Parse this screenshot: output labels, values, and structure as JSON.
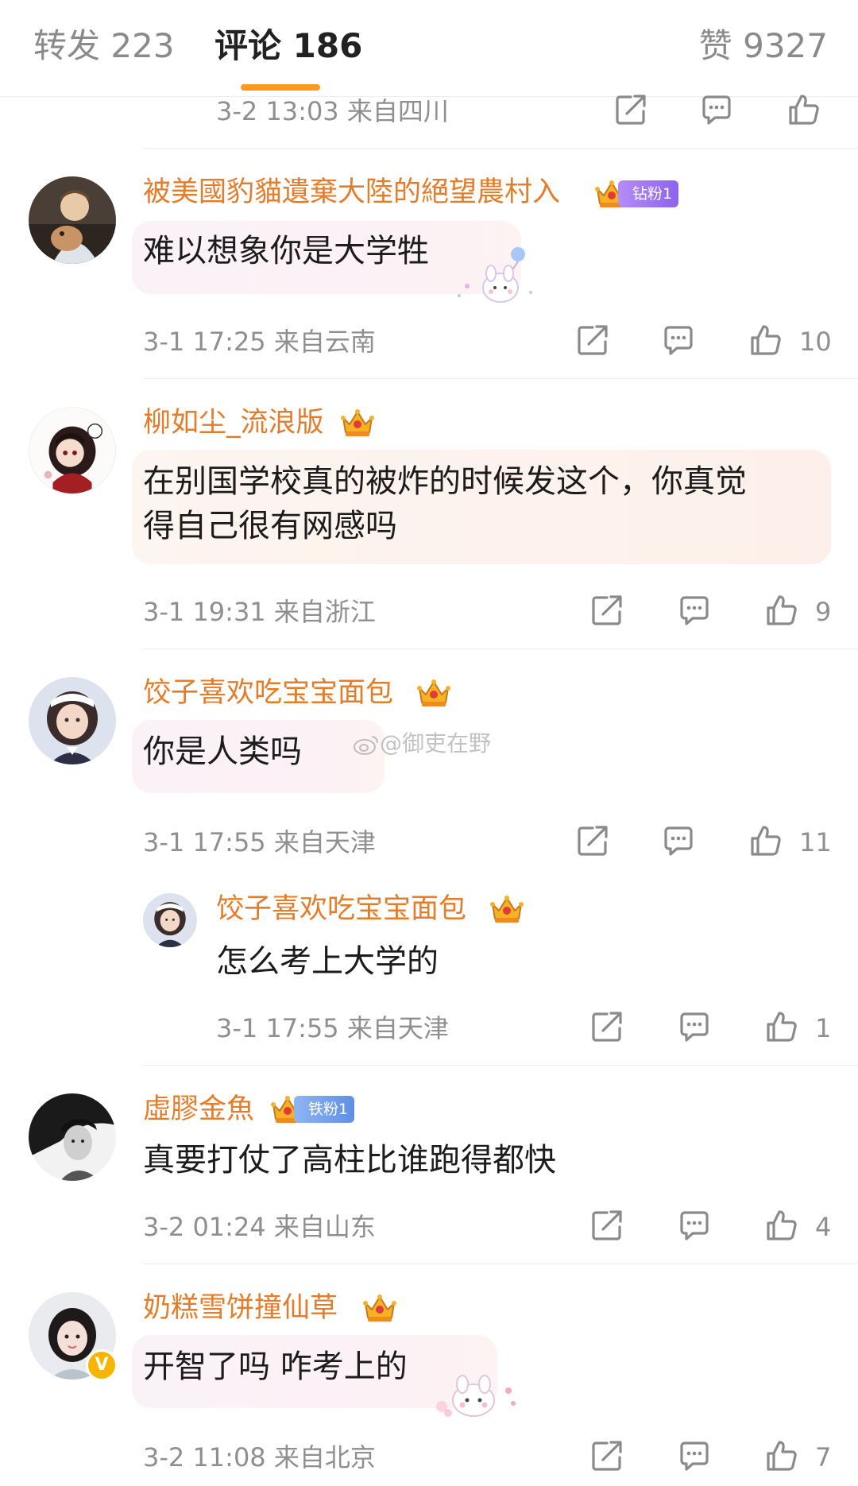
{
  "tabs": {
    "forward": "转发 223",
    "comments": "评论 186",
    "likes": "赞 9327"
  },
  "top_meta": "3-2 13:03 来自四川",
  "comments": [
    {
      "user": "被美國豹貓遺棄大陸的絕望農村入",
      "badge": "钻粉1",
      "text": "难以想象你是大学牲",
      "meta": "3-1 17:25 来自云南",
      "likes": "10"
    },
    {
      "user": "柳如尘_流浪版",
      "text_line1": "在别国学校真的被炸的时候发这个，你真觉",
      "text_line2": "得自己很有网感吗",
      "meta": "3-1 19:31 来自浙江",
      "likes": "9"
    },
    {
      "user": "饺子喜欢吃宝宝面包",
      "text": "你是人类吗",
      "meta": "3-1 17:55 来自天津",
      "likes": "11",
      "reply": {
        "user": "饺子喜欢吃宝宝面包",
        "text": "怎么考上大学的",
        "meta": "3-1 17:55 来自天津",
        "likes": "1"
      }
    },
    {
      "user": "虛膠金魚",
      "badge": "铁粉1",
      "text": "真要打仗了高柱比谁跑得都快",
      "meta": "3-2 01:24 来自山东",
      "likes": "4"
    },
    {
      "user": "奶糕雪饼撞仙草",
      "text": "开智了吗 咋考上的",
      "meta": "3-2 11:08 来自北京",
      "likes": "7"
    }
  ],
  "watermark": "@御吏在野",
  "icons": [
    "share-icon",
    "comment-icon",
    "like-icon",
    "crown-icon",
    "verified-icon"
  ],
  "colors": {
    "accent": "#ff9a1f",
    "username": "#e57c2a",
    "meta": "#8f8f8f"
  }
}
